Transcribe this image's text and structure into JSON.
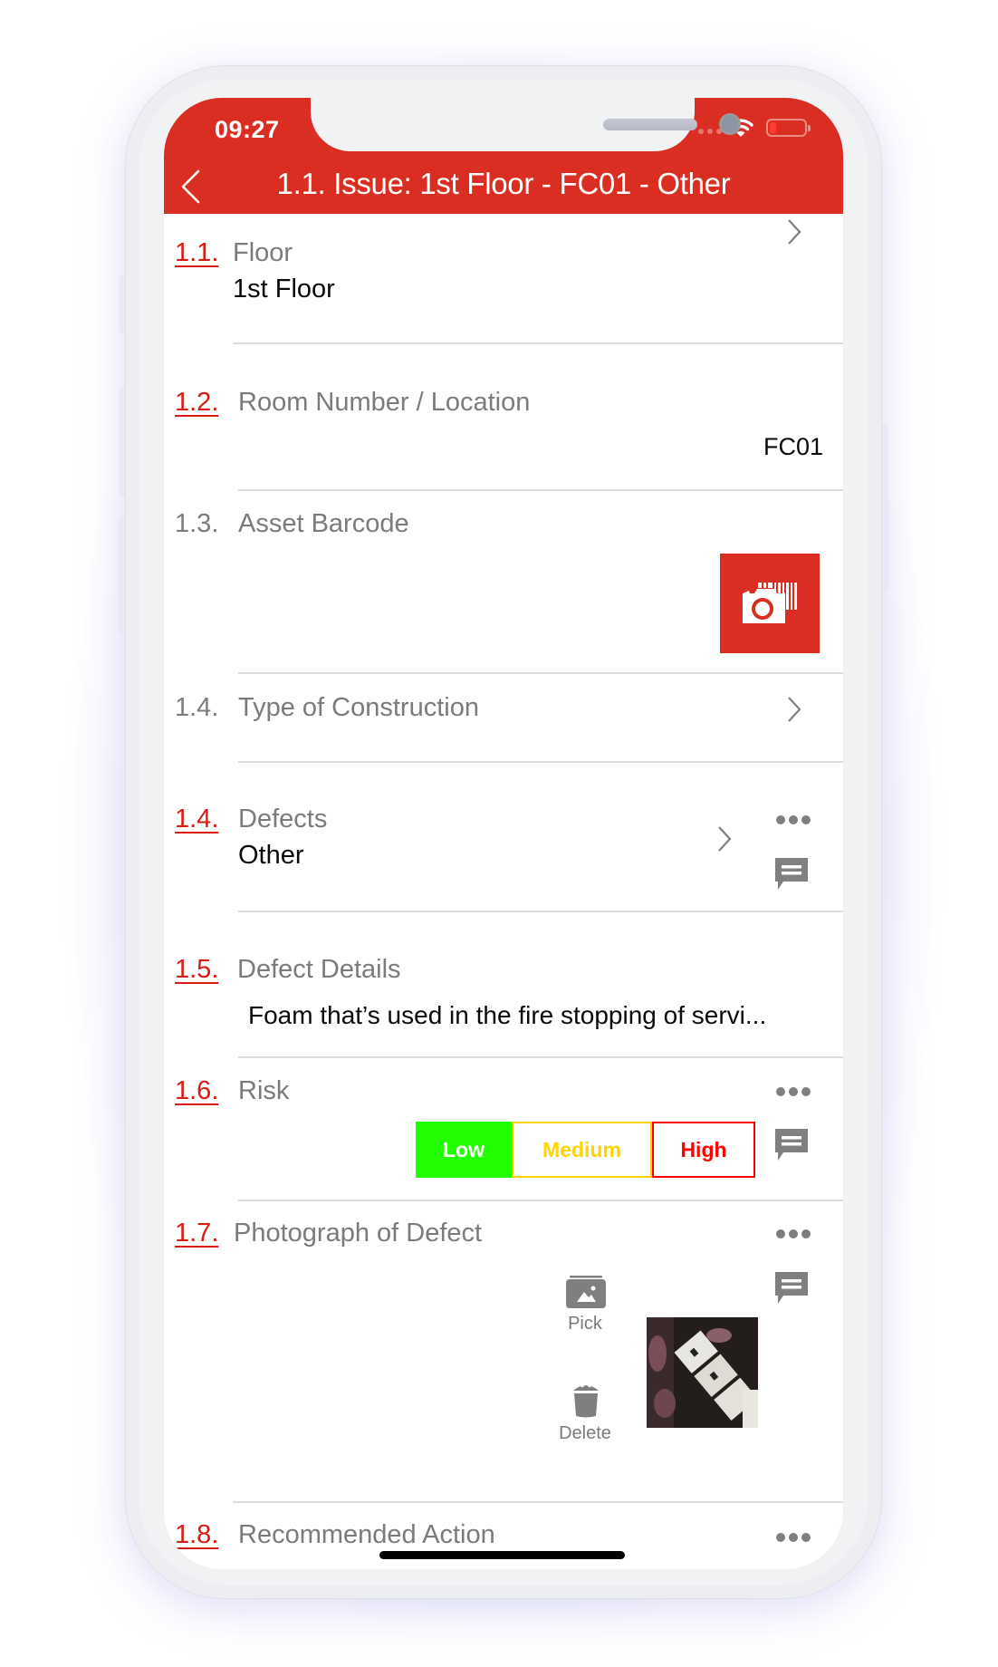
{
  "status_bar": {
    "time": "09:27",
    "icons": [
      "signal-dots-icon",
      "wifi-icon",
      "battery-low-icon"
    ]
  },
  "header": {
    "back_icon": "chevron-left-icon",
    "title": "1.1. Issue: 1st Floor - FC01  - Other",
    "background_color": "#db2e22"
  },
  "rows": [
    {
      "number": "1.1.",
      "label": "Floor",
      "value": "1st Floor",
      "required": true,
      "action": "chevron-right-icon"
    },
    {
      "number": "1.2.",
      "label": "Room Number / Location",
      "value": "FC01",
      "required": true
    },
    {
      "number": "1.3.",
      "label": "Asset Barcode",
      "required": false,
      "action": "barcode-camera-icon"
    },
    {
      "number": "1.4.",
      "label": "Type of Construction",
      "required": false,
      "action": "chevron-right-icon"
    },
    {
      "number": "1.4.",
      "label": "Defects",
      "value": "Other",
      "required": true,
      "action": "chevron-right-icon"
    },
    {
      "number": "1.5.",
      "label": "Defect Details",
      "value": "Foam that’s used in the fire stopping of servi...",
      "required": true
    },
    {
      "number": "1.6.",
      "label": "Risk",
      "required": true
    },
    {
      "number": "1.7.",
      "label": "Photograph of Defect",
      "required": true
    },
    {
      "number": "1.8.",
      "label": "Recommended Action",
      "required": true
    }
  ],
  "risk": {
    "options": [
      {
        "label": "Low",
        "color": "#22ff00",
        "selected": true
      },
      {
        "label": "Medium",
        "color": "#ffd400",
        "selected": false
      },
      {
        "label": "High",
        "color": "#ff0000",
        "selected": false
      }
    ]
  },
  "photo": {
    "pick_label": "Pick",
    "delete_label": "Delete"
  },
  "colors": {
    "accent_red": "#db2e22",
    "required_number_red": "#d91c13",
    "label_gray": "#7b7b7b",
    "icon_gray": "#7f7f7f"
  }
}
